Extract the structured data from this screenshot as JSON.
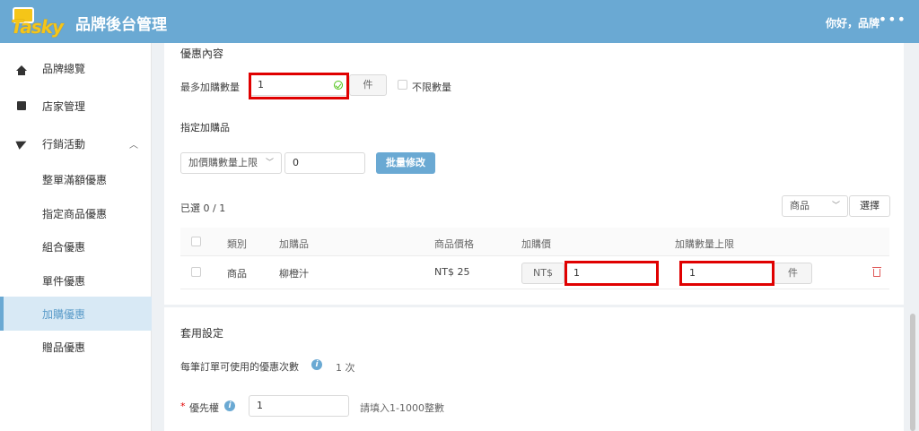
{
  "header": {
    "logo_text": "Tasky",
    "title": "品牌後台管理",
    "greeting": "你好，品牌",
    "more_label": "•••"
  },
  "sidebar": {
    "items": [
      {
        "label": "品牌總覽",
        "icon": "home-icon"
      },
      {
        "label": "店家管理",
        "icon": "store-icon"
      },
      {
        "label": "行銷活動",
        "icon": "paper-plane-icon"
      },
      {
        "label": "整單滿額優惠"
      },
      {
        "label": "指定商品優惠"
      },
      {
        "label": "組合優惠"
      },
      {
        "label": "單件優惠"
      },
      {
        "label": "加購優惠"
      },
      {
        "label": "贈品優惠"
      }
    ],
    "active": "加購優惠"
  },
  "discount": {
    "section_title": "優惠內容",
    "max_qty_label": "最多加購數量",
    "max_qty_value": "1",
    "unit": "件",
    "unlimited_label": "不限數量"
  },
  "addon_items": {
    "section_title": "指定加購品",
    "batch_select": "加價購數量上限",
    "batch_value": "0",
    "batch_button": "批量修改",
    "selected_count": "已選 0 / 1",
    "filter_select": "商品",
    "select_button": "選擇",
    "columns": [
      "類別",
      "加購品",
      "商品價格",
      "加購價",
      "加購數量上限"
    ],
    "rows": [
      {
        "category": "商品",
        "name": "柳橙汁",
        "price": "NT$ 25",
        "currency": "NT$",
        "addon_price": "1",
        "limit": "1",
        "unit": "件"
      }
    ]
  },
  "apply": {
    "section_title": "套用設定",
    "per_order_label": "每筆訂單可使用的優惠次數",
    "per_order_value": "1 次",
    "priority_label": "優先權",
    "priority_required": "*",
    "priority_value": "1",
    "priority_hint": "請填入1-1000整數"
  },
  "colors": {
    "primary": "#6aa9d3",
    "highlight": "#e00000",
    "active_bg": "#d8e9f5"
  }
}
